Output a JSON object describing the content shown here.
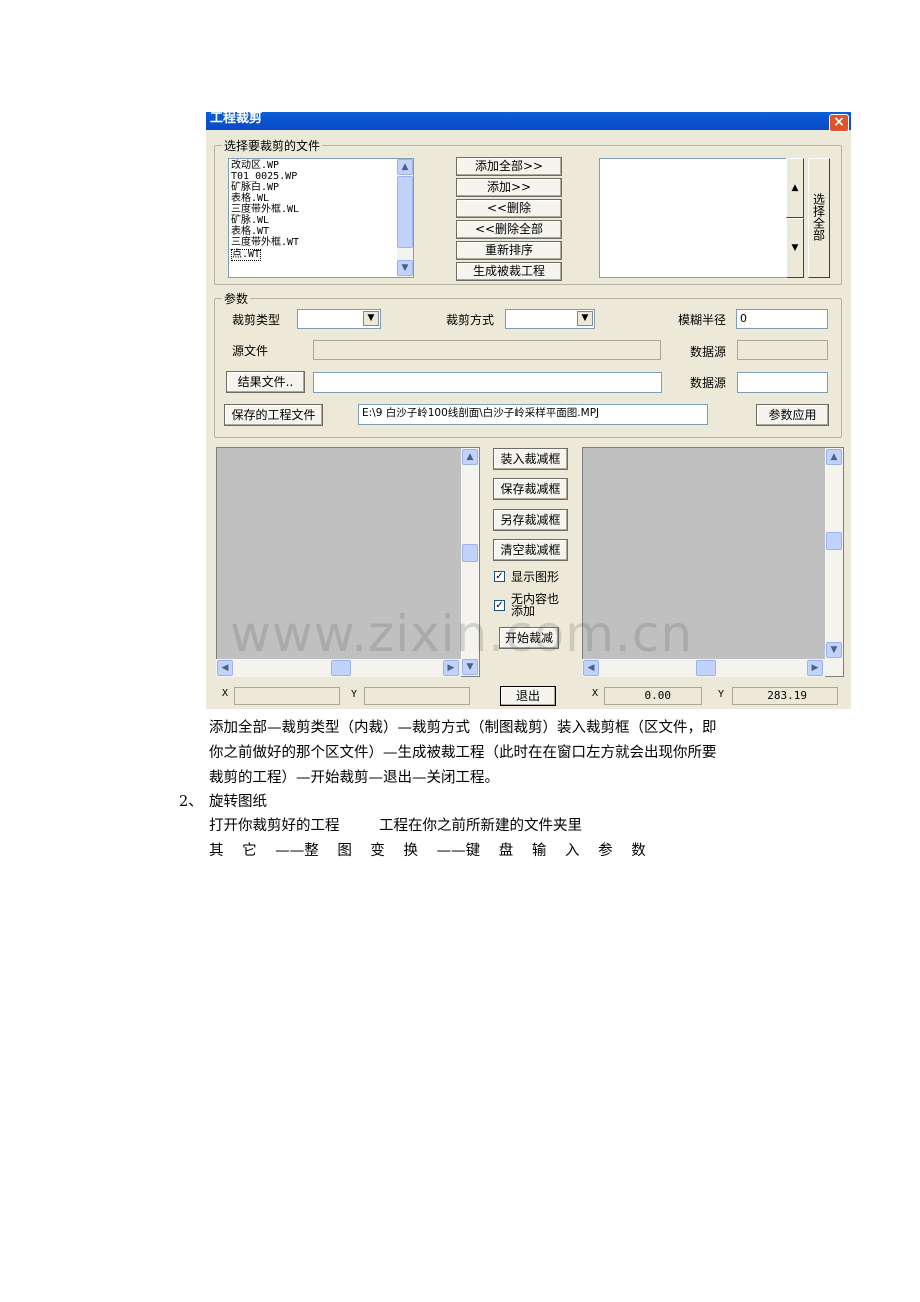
{
  "dialog": {
    "title": "工程裁剪",
    "close": "×",
    "file_group": {
      "legend": "选择要裁剪的文件",
      "files": [
        "改动区.WP",
        "T01_0025.WP",
        "矿脉白.WP",
        "表格.WL",
        "三度带外框.WL",
        "矿脉.WL",
        "表格.WT",
        "三度带外框.WT",
        "点.WT"
      ],
      "buttons": [
        "添加全部>>",
        "添加>>",
        "<<删除",
        "<<删除全部",
        "重新排序",
        "生成被裁工程"
      ],
      "select_all": "选择全部"
    },
    "params": {
      "legend": "参数",
      "clip_type_label": "裁剪类型",
      "clip_type_value": "",
      "clip_mode_label": "裁剪方式",
      "clip_mode_value": "",
      "blur_radius_label": "模糊半径",
      "blur_radius_value": "0",
      "source_file_label": "源文件",
      "source_file_value": "",
      "data_source_label_1": "数据源",
      "data_source_value_1": "",
      "result_file_button": "结果文件..",
      "result_file_value": "",
      "data_source_label_2": "数据源",
      "data_source_value_2": "",
      "saved_project_button": "保存的工程文件",
      "saved_project_path": "E:\\9 白沙子岭100线剖面\\白沙子岭采样平面图.MPJ",
      "apply_button": "参数应用"
    },
    "clip_controls": {
      "load_frame": "装入裁减框",
      "save_frame": "保存裁减框",
      "save_frame_as": "另存裁减框",
      "clear_frame": "清空裁减框",
      "show_graphic_label": "显示图形",
      "show_graphic_checked": true,
      "add_empty_label": "无内容也添加",
      "add_empty_checked": true,
      "start_clip": "开始裁减",
      "exit": "退出"
    },
    "status": {
      "left_x_label": "X",
      "left_x_value": "",
      "left_y_label": "Y",
      "left_y_value": "",
      "right_x_label": "X",
      "right_x_value": "0.00",
      "right_y_label": "Y",
      "right_y_value": "283.19"
    }
  },
  "watermark": "www.zixin.com.cn",
  "text": {
    "line1": "添加全部—裁剪类型（内裁）—裁剪方式（制图裁剪）装入裁剪框（区文件，即",
    "line2": "你之前做好的那个区文件）—生成被裁工程（此时在在窗口左方就会出现你所要",
    "line3": "裁剪的工程）—开始裁剪—退出—关闭工程。",
    "item_number": "2、",
    "item_title": "旋转图纸",
    "line5a": "打开你裁剪好的工程",
    "line5b": "工程在你之前所新建的文件夹里",
    "line6": "其 它 ——整 图 变 换 ——键 盘 输 入 参 数"
  }
}
